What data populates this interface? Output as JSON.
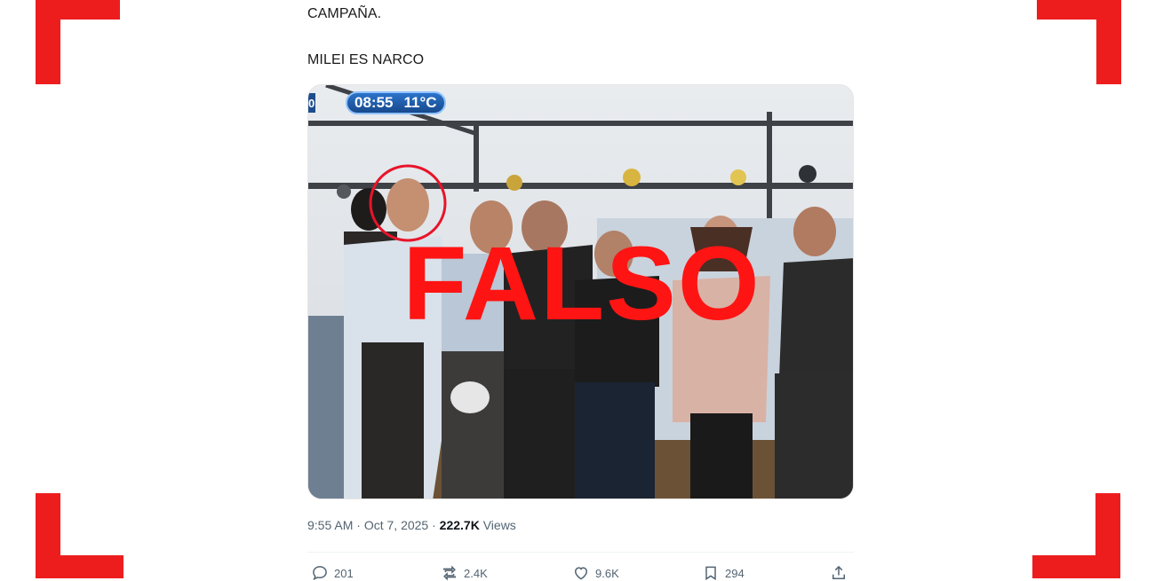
{
  "tweet": {
    "text_line_1": "CAMPAÑA.",
    "text_line_2": "MILEI ES NARCO",
    "media": {
      "tv_time": "08:55",
      "tv_temp": "11°C",
      "tv_channel_fragment": "0",
      "overlay_stamp": "FALSO",
      "stamp_color": "#ff1414"
    },
    "meta": {
      "time": "9:55 AM",
      "separator": "·",
      "date": "Oct 7, 2025",
      "views_count": "222.7K",
      "views_label": "Views"
    },
    "actions": {
      "replies": "201",
      "reposts": "2.4K",
      "likes": "9.6K",
      "bookmarks": "294"
    }
  },
  "frame": {
    "corner_color": "#ee1d1d"
  },
  "icons": [
    "reply-icon",
    "repost-icon",
    "like-icon",
    "bookmark-icon",
    "share-icon"
  ]
}
